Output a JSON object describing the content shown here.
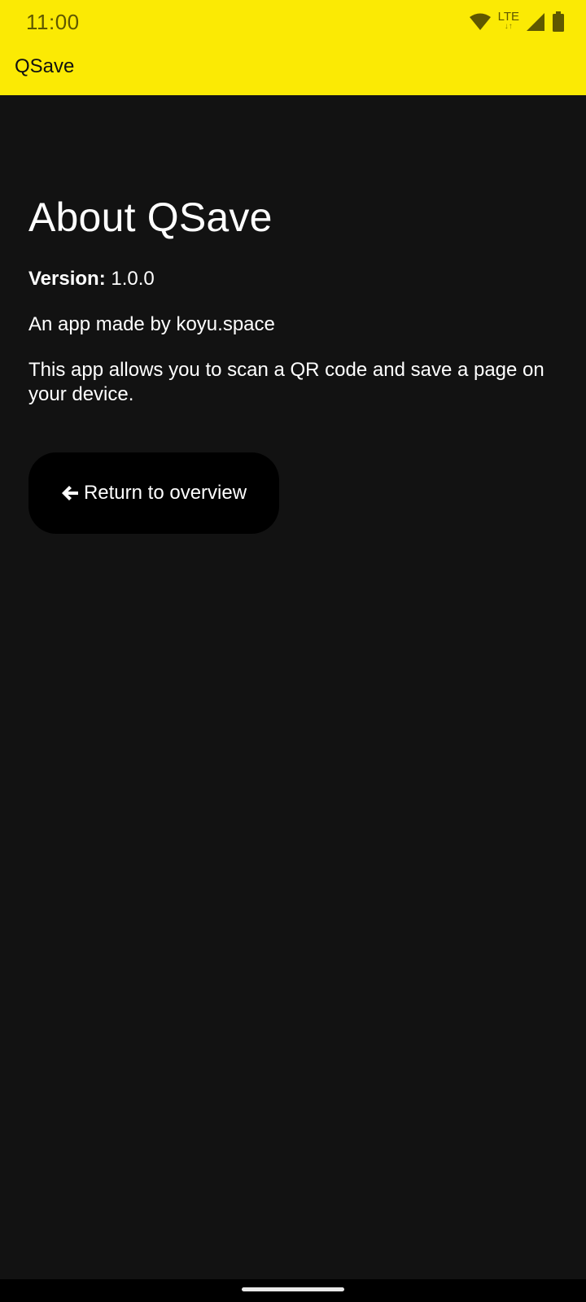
{
  "status_bar": {
    "time": "11:00",
    "network_label": "LTE",
    "network_arrows": "↓↑",
    "icons": [
      "wifi-icon",
      "signal-icon",
      "battery-icon"
    ]
  },
  "app_bar": {
    "title": "QSave"
  },
  "about": {
    "heading": "About QSave",
    "version_label": "Version:",
    "version_value": "1.0.0",
    "made_by": "An app made by koyu.space",
    "description": "This app allows you to scan a QR code and save a page on your device."
  },
  "return_button": {
    "label": "Return to overview",
    "icon": "arrow-left-icon"
  },
  "colors": {
    "app_bar": "#fbea04",
    "background": "#121212",
    "button": "#000000",
    "text": "#ffffff"
  }
}
